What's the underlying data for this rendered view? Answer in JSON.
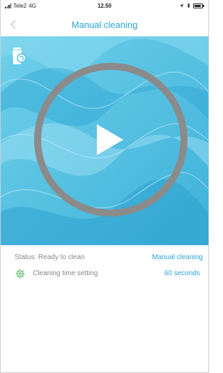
{
  "status_bar": {
    "carrier": "Tele2",
    "network": "4G",
    "time": "12.50"
  },
  "nav": {
    "title": "Manual cleaning",
    "back_icon": "chevron-left-icon"
  },
  "hero": {
    "bin_icon": "trash-bin-icon",
    "play_icon": "play-icon",
    "colors": {
      "background": "#4fc0e2",
      "ring": "#8b8b8b",
      "accent": "#2aa4d6"
    }
  },
  "status": {
    "label": "Status: Ready to clean",
    "mode": "Manual cleaning"
  },
  "setting": {
    "icon": "gear-icon",
    "label": "Cleaning time setting",
    "value": "60 seconds"
  }
}
